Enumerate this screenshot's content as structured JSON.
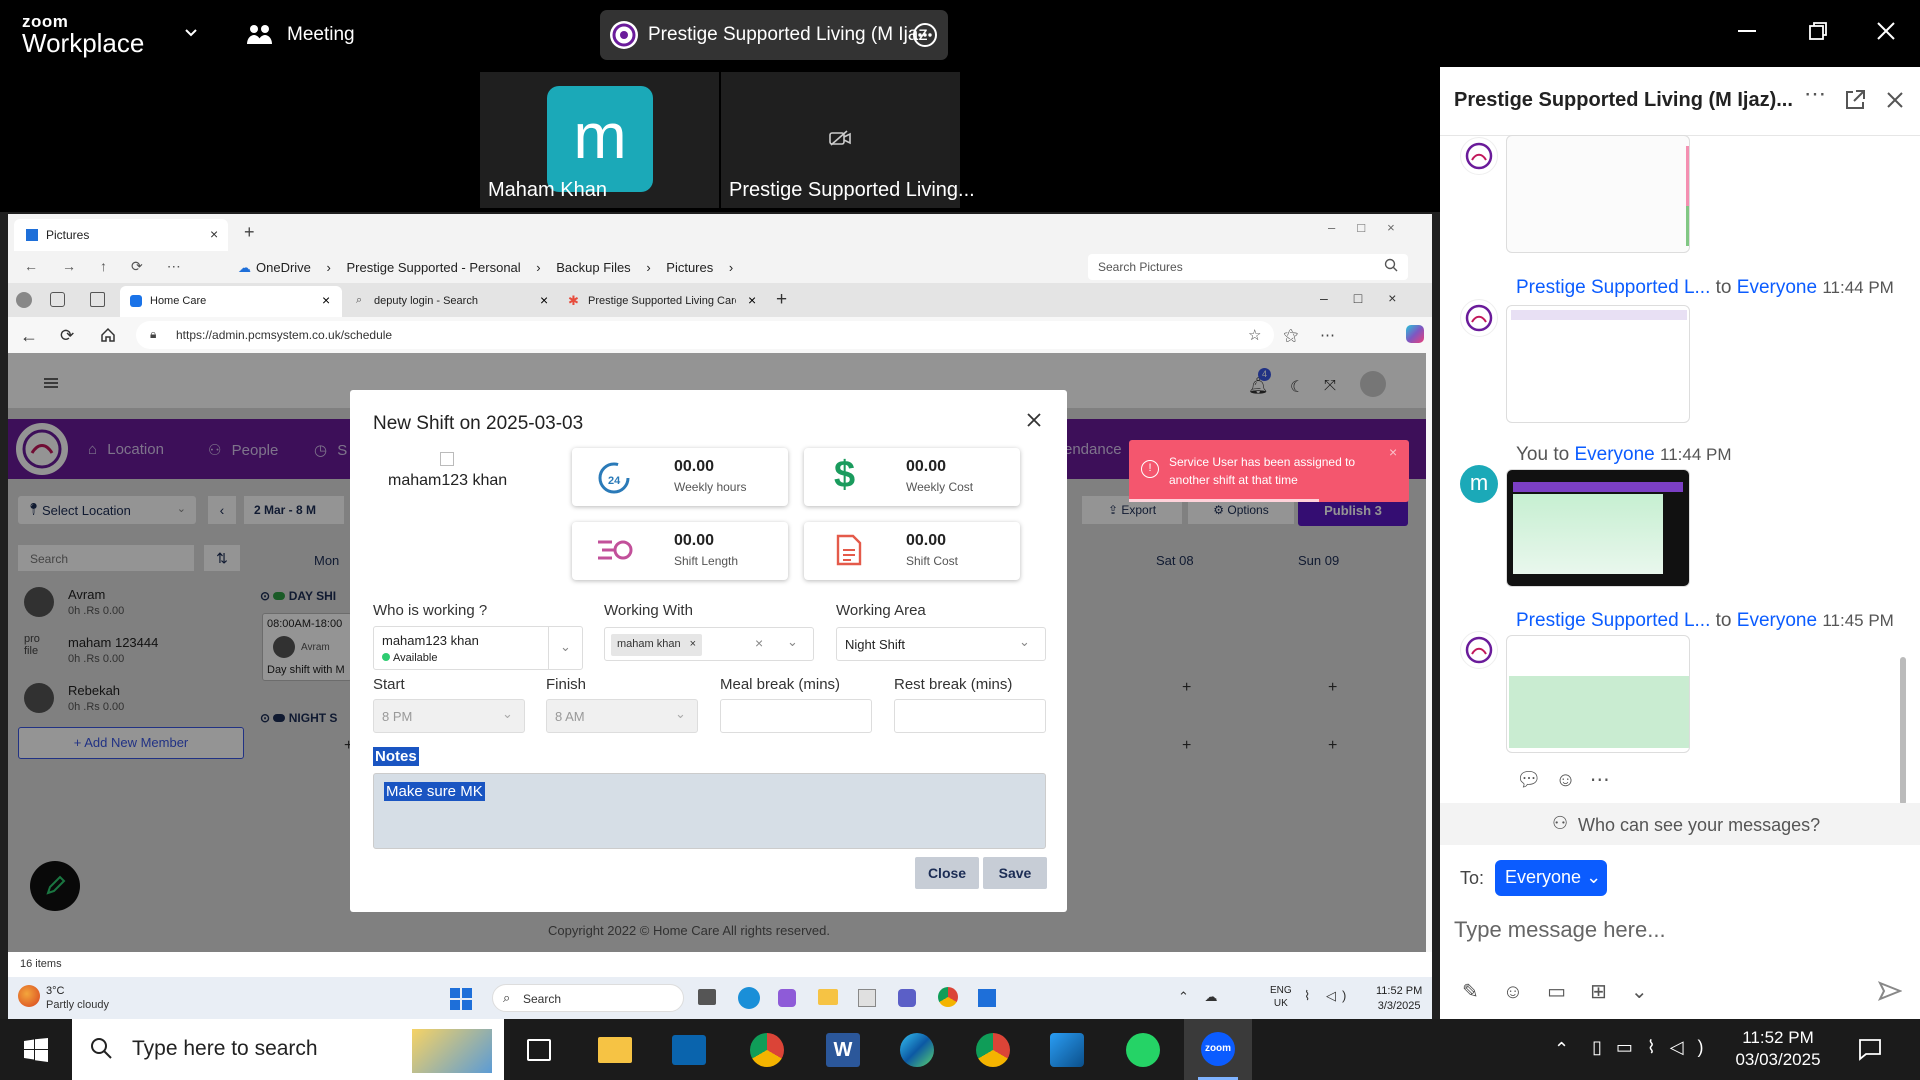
{
  "zoom_bar": {
    "logo_top": "zoom",
    "logo_bottom": "Workplace",
    "meeting_label": "Meeting",
    "active_tab_title": "Prestige Supported Living (M Ijaz"
  },
  "participants": [
    {
      "initial": "m",
      "name": "Maham Khan"
    },
    {
      "initial": "",
      "name": "Prestige Supported Living..."
    }
  ],
  "explorer": {
    "tab_title": "Pictures",
    "breadcrumb": [
      "OneDrive",
      "Prestige Supported - Personal",
      "Backup Files",
      "Pictures"
    ],
    "search_placeholder": "Search Pictures",
    "status_items": "16 items"
  },
  "browser": {
    "tabs": [
      "Home Care",
      "deputy login - Search",
      "Prestige Supported Living Care -"
    ],
    "url": "https://admin.pcmsystem.co.uk/schedule"
  },
  "app": {
    "nav": [
      "Location",
      "People",
      "S"
    ],
    "nav_right": "endance",
    "select_location": "Select Location",
    "date_range": "2 Mar - 8 M",
    "search_placeholder": "Search",
    "day_header": "Mon",
    "sat": "Sat 08",
    "sun": "Sun 09",
    "export": "Export",
    "options": "Options",
    "publish": "Publish 3",
    "notif_count": "4",
    "day_shift": "DAY SHI",
    "night_shift": "NIGHT S",
    "shift_card_time": "08:00AM-18:00",
    "shift_card_name": "Avram",
    "shift_card_desc": "Day shift with M",
    "add_member": "Add New Member",
    "copyright": "Copyright 2022 © Home Care All rights reserved.",
    "people": [
      {
        "name": "Avram",
        "meta": "0h .Rs 0.00"
      },
      {
        "name": "maham 123444",
        "meta": "0h .Rs 0.00",
        "img_alt": "pro file"
      },
      {
        "name": "Rebekah",
        "meta": "0h .Rs 0.00"
      }
    ]
  },
  "toast": {
    "message": "Service User has been assigned to another shift at that time"
  },
  "modal": {
    "title": "New Shift on 2025-03-03",
    "user_name": "maham123 khan",
    "stats": [
      {
        "value": "00.00",
        "label": "Weekly hours",
        "icon": "clock-24-icon"
      },
      {
        "value": "00.00",
        "label": "Weekly Cost",
        "icon": "dollar-icon"
      },
      {
        "value": "00.00",
        "label": "Shift Length",
        "icon": "fast-forward-icon"
      },
      {
        "value": "00.00",
        "label": "Shift Cost",
        "icon": "document-icon"
      }
    ],
    "who_label": "Who is working ?",
    "who_value": "maham123 khan",
    "who_status": "Available",
    "with_label": "Working With",
    "with_tag": "maham khan",
    "area_label": "Working Area",
    "area_value": "Night Shift",
    "start_label": "Start",
    "start_value": "8 PM",
    "finish_label": "Finish",
    "finish_value": "8 AM",
    "meal_label": "Meal break (mins)",
    "rest_label": "Rest break (mins)",
    "notes_label": "Notes",
    "notes_value": "Make sure MK",
    "close_btn": "Close",
    "save_btn": "Save"
  },
  "chat": {
    "title": "Prestige Supported Living (M Ijaz)...",
    "messages": [
      {
        "from": "Prestige Supported L...",
        "to": "to",
        "audience": "Everyone",
        "time": "11:44 PM"
      },
      {
        "from": "You to",
        "audience": "Everyone",
        "time": "11:44 PM"
      },
      {
        "from": "Prestige Supported L...",
        "to": "to",
        "audience": "Everyone",
        "time": "11:45 PM"
      }
    ],
    "visibility_note": "Who can see your messages?",
    "to_label": "To:",
    "to_value": "Everyone",
    "input_placeholder": "Type message here..."
  },
  "inner_taskbar": {
    "weather_temp": "3°C",
    "weather_desc": "Partly cloudy",
    "search": "Search",
    "lang_top": "ENG",
    "lang_bottom": "UK",
    "time": "11:52 PM",
    "date": "3/3/2025"
  },
  "taskbar": {
    "search_placeholder": "Type here to search",
    "time": "11:52 PM",
    "date": "03/03/2025"
  },
  "colors": {
    "zoom_blue": "#0b5cff",
    "app_purple": "#6a1b9a",
    "toast_red": "#f4566e",
    "publish_purple": "#5b17c4"
  }
}
